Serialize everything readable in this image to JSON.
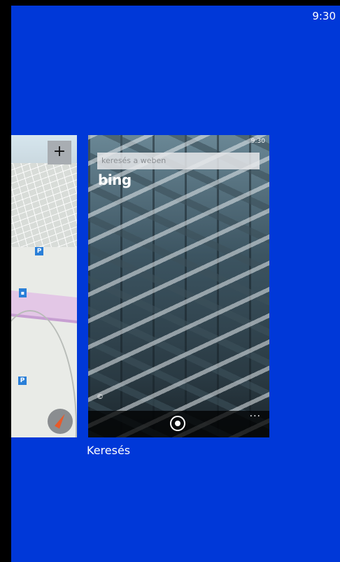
{
  "status": {
    "time": "9:30"
  },
  "map_card": {
    "zoom_in_label": "+",
    "parking_label": "P"
  },
  "bing_card": {
    "time": "9:30",
    "search_placeholder": "keresés a weben",
    "logo": "bing",
    "copyright": "©",
    "more_label": "..."
  },
  "app_label": "Keresés",
  "colors": {
    "background": "#0038d8",
    "accent": "#2a7fd8"
  }
}
